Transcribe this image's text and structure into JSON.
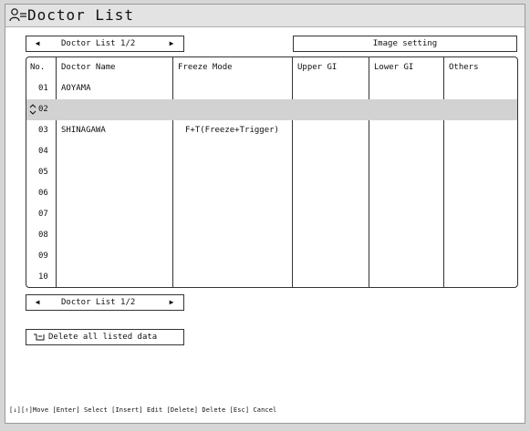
{
  "header": {
    "title": "Doctor List",
    "icon": "doctor-list-icon"
  },
  "pager_top": {
    "label": "Doctor List 1/2",
    "prev_icon": "◀",
    "next_icon": "▶"
  },
  "image_setting": {
    "label": "Image setting"
  },
  "table": {
    "headers": [
      "No.",
      "Doctor Name",
      "Freeze Mode",
      "Upper GI",
      "Lower GI",
      "Others"
    ],
    "rows": [
      {
        "no": "01",
        "name": "AOYAMA",
        "freeze": ""
      },
      {
        "no": "02",
        "name": "",
        "freeze": ""
      },
      {
        "no": "03",
        "name": "SHINAGAWA",
        "freeze": "F+T(Freeze+Trigger)"
      },
      {
        "no": "04",
        "name": "",
        "freeze": ""
      },
      {
        "no": "05",
        "name": "",
        "freeze": ""
      },
      {
        "no": "06",
        "name": "",
        "freeze": ""
      },
      {
        "no": "07",
        "name": "",
        "freeze": ""
      },
      {
        "no": "08",
        "name": "",
        "freeze": ""
      },
      {
        "no": "09",
        "name": "",
        "freeze": ""
      },
      {
        "no": "10",
        "name": "",
        "freeze": ""
      }
    ],
    "selected_row": "02"
  },
  "pager_bottom": {
    "label": "Doctor List 1/2",
    "prev_icon": "◀",
    "next_icon": "▶"
  },
  "delete_all": {
    "label": "Delete all listed data"
  },
  "footer": {
    "hint": "[↓][↑]Move [Enter] Select [Insert] Edit [Delete] Delete [Esc] Cancel"
  },
  "colors": {
    "title_bg": "#e3e3e3",
    "selected_row_bg": "#d2d2d2",
    "border": "#333333"
  }
}
